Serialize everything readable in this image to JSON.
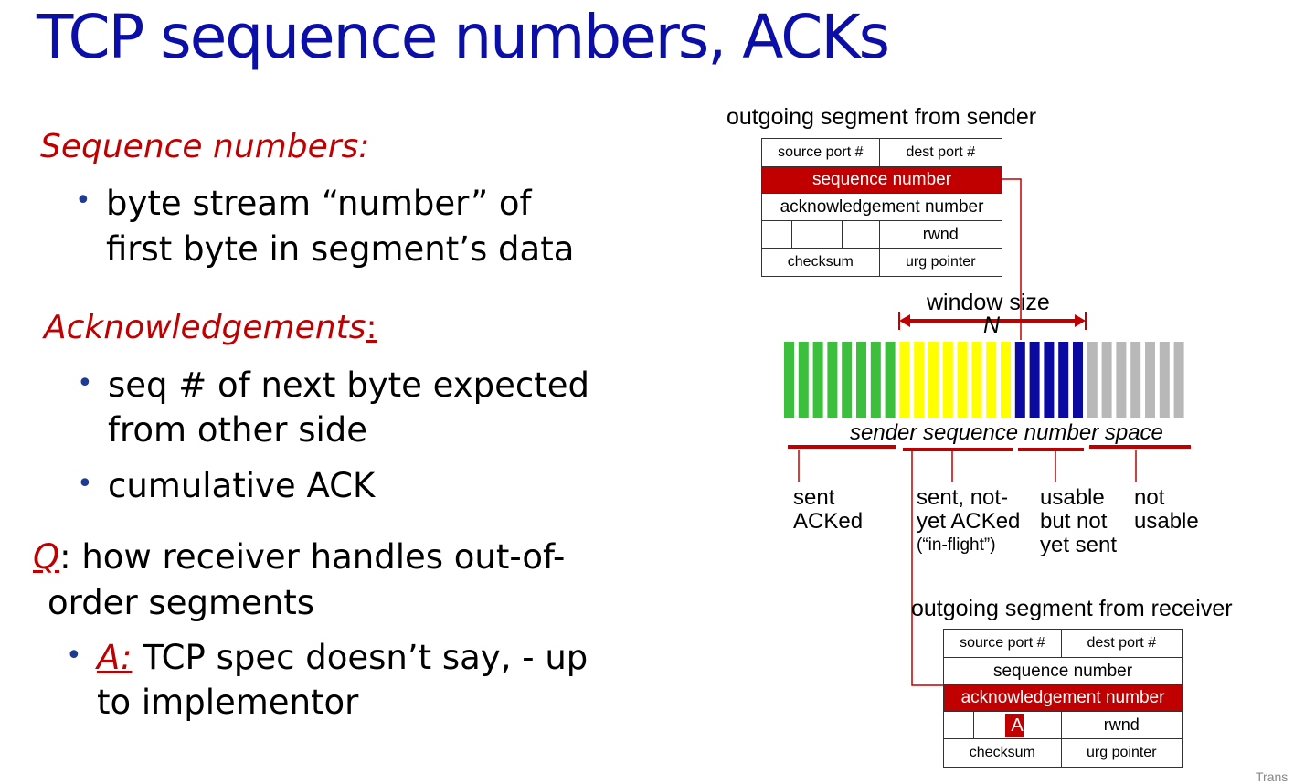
{
  "title": "TCP sequence numbers, ACKs",
  "left": {
    "seq_heading": "Sequence numbers:",
    "seq_bullet": [
      "byte stream “number” of",
      "first byte in segment’s data"
    ],
    "ack_heading": "Acknowledgements",
    "ack_colon": ":",
    "ack_bullet1": [
      "seq # of next byte expected",
      "from other side"
    ],
    "ack_bullet2": "cumulative ACK",
    "q_label": "Q",
    "q_text_line1": ": how receiver handles out-of-",
    "q_text_line2": "order segments",
    "a_label": "A:",
    "a_text_line1": " TCP spec doesn’t say, - up",
    "a_text_line2": "to implementor"
  },
  "sender_segment": {
    "caption": "outgoing segment from sender",
    "source_port": "source port #",
    "dest_port": "dest port #",
    "sequence_number": "sequence number",
    "ack_number": "acknowledgement number",
    "rwnd": "rwnd",
    "checksum": "checksum",
    "urg_pointer": "urg pointer"
  },
  "window": {
    "label": "window size",
    "n": "N",
    "space_label": "sender sequence number space",
    "groups": [
      {
        "name": "sent ACKed",
        "color": "#3cbf3c",
        "bars": 8
      },
      {
        "name": "sent, not-yet ACKed",
        "color": "#ffff00",
        "bars": 8
      },
      {
        "name": "usable but not yet sent",
        "color": "#0a0aa0",
        "bars": 5
      },
      {
        "name": "not usable",
        "color": "#b8b8b8",
        "bars": 7
      }
    ],
    "legend": {
      "sent_acked": [
        "sent",
        "ACKed"
      ],
      "in_flight": [
        "sent, not-",
        "yet ACKed"
      ],
      "in_flight_note": "(“in-flight”)",
      "usable": [
        "usable",
        "but not",
        "yet sent"
      ],
      "not_usable": [
        "not",
        "usable"
      ]
    }
  },
  "receiver_segment": {
    "caption": "outgoing segment from receiver",
    "source_port": "source port #",
    "dest_port": "dest port #",
    "sequence_number": "sequence number",
    "ack_number": "acknowledgement number",
    "a_flag": "A",
    "rwnd": "rwnd",
    "checksum": "checksum",
    "urg_pointer": "urg pointer"
  },
  "footer_cut": "Trans"
}
